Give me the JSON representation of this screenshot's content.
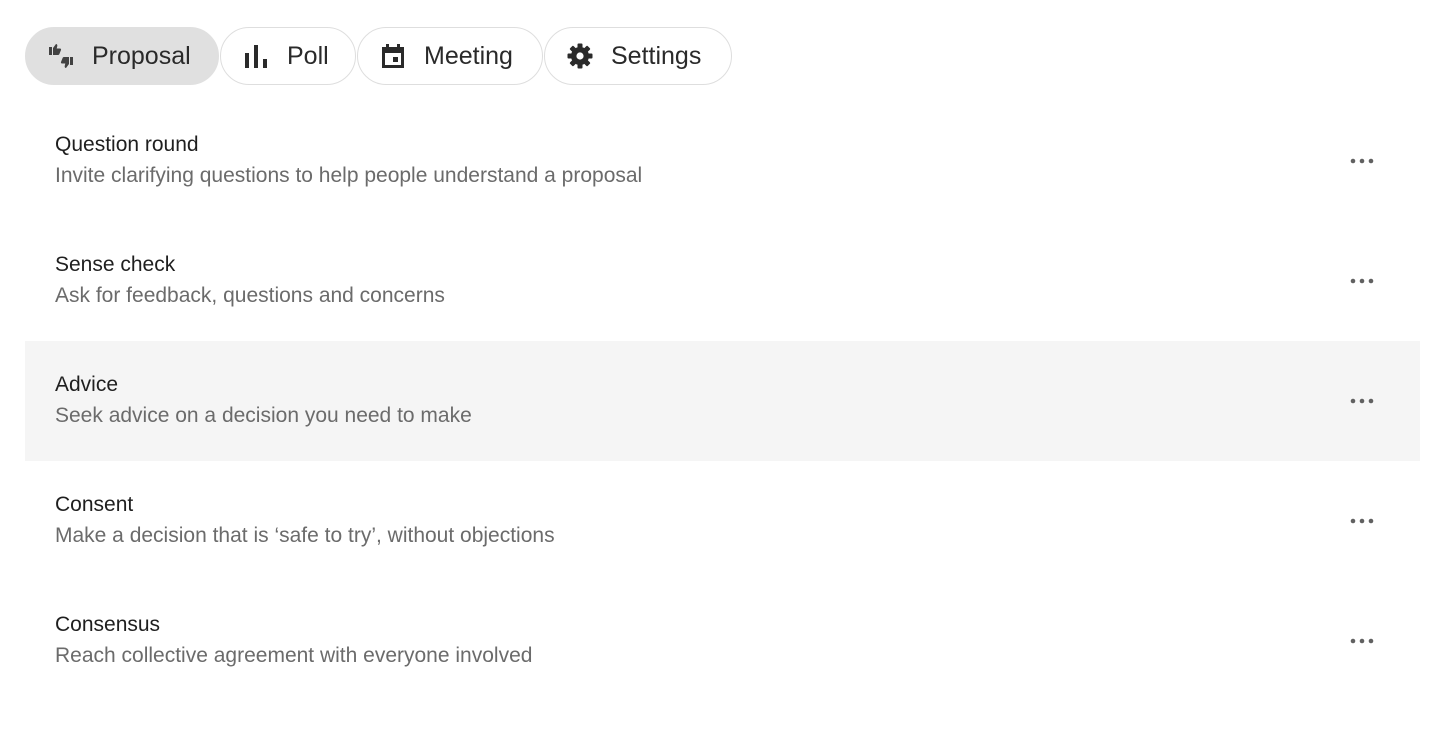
{
  "tabs": [
    {
      "label": "Proposal",
      "icon": "thumbs-up-down-icon",
      "active": true
    },
    {
      "label": "Poll",
      "icon": "bar-chart-icon",
      "active": false
    },
    {
      "label": "Meeting",
      "icon": "calendar-icon",
      "active": false
    },
    {
      "label": "Settings",
      "icon": "gear-icon",
      "active": false
    }
  ],
  "templates": [
    {
      "title": "Question round",
      "description": "Invite clarifying questions to help people understand a proposal"
    },
    {
      "title": "Sense check",
      "description": "Ask for feedback, questions and concerns"
    },
    {
      "title": "Advice",
      "description": "Seek advice on a decision you need to make"
    },
    {
      "title": "Consent",
      "description": "Make a decision that is ‘safe to try’, without objections"
    },
    {
      "title": "Consensus",
      "description": "Reach collective agreement with everyone involved"
    }
  ],
  "colors": {
    "active_chip": "#e0e0e0",
    "hover_row": "#f5f5f5",
    "description_text": "#6b6b6b"
  }
}
